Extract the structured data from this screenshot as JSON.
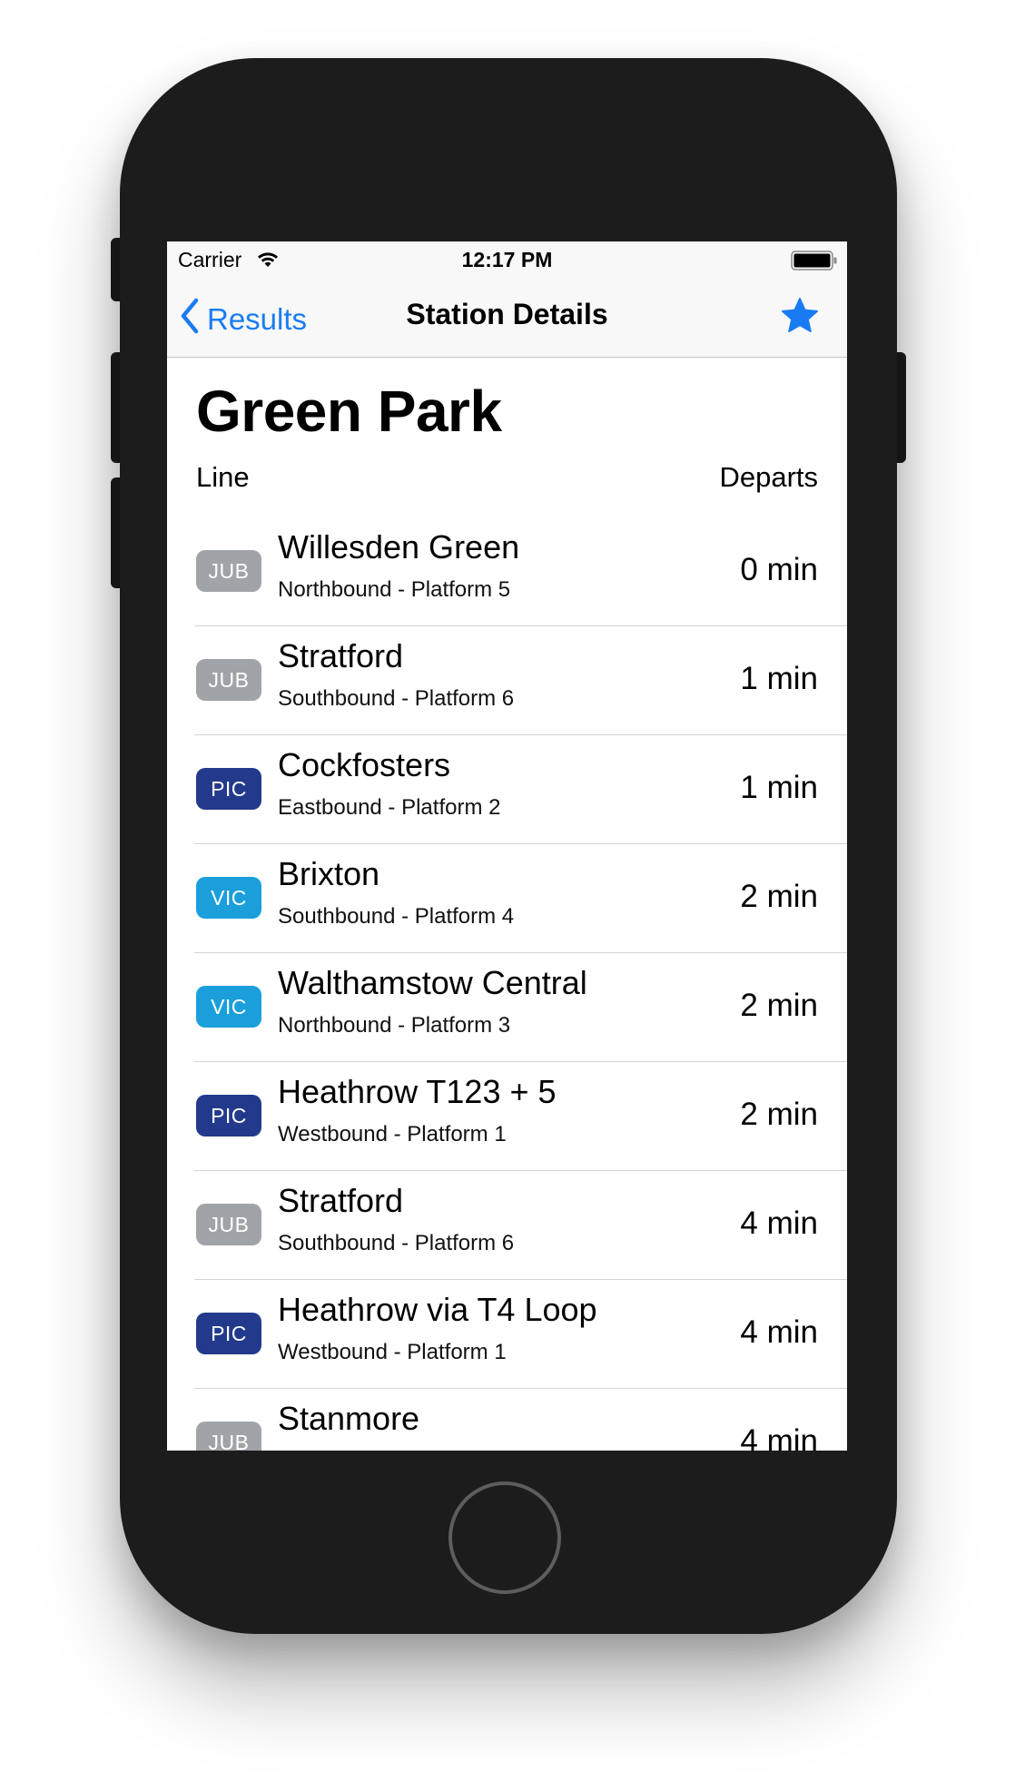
{
  "status_bar": {
    "carrier": "Carrier",
    "time": "12:17 PM"
  },
  "nav": {
    "back_label": "Results",
    "title": "Station Details",
    "favorite_icon": "star-icon"
  },
  "station": {
    "name": "Green Park",
    "col_line": "Line",
    "col_departs": "Departs"
  },
  "colors": {
    "accent": "#1a7cf2",
    "JUB": "#a0a3a7",
    "PIC": "#233a8c",
    "VIC": "#1a9fdb"
  },
  "departures": [
    {
      "line": "JUB",
      "destination": "Willesden Green",
      "platform": "Northbound - Platform 5",
      "departs": "0 min"
    },
    {
      "line": "JUB",
      "destination": "Stratford",
      "platform": "Southbound - Platform 6",
      "departs": "1 min"
    },
    {
      "line": "PIC",
      "destination": "Cockfosters",
      "platform": "Eastbound - Platform 2",
      "departs": "1 min"
    },
    {
      "line": "VIC",
      "destination": "Brixton",
      "platform": "Southbound - Platform 4",
      "departs": "2 min"
    },
    {
      "line": "VIC",
      "destination": "Walthamstow Central",
      "platform": "Northbound - Platform 3",
      "departs": "2 min"
    },
    {
      "line": "PIC",
      "destination": "Heathrow T123 + 5",
      "platform": "Westbound - Platform 1",
      "departs": "2 min"
    },
    {
      "line": "JUB",
      "destination": "Stratford",
      "platform": "Southbound - Platform 6",
      "departs": "4 min"
    },
    {
      "line": "PIC",
      "destination": "Heathrow via T4 Loop",
      "platform": "Westbound - Platform 1",
      "departs": "4 min"
    },
    {
      "line": "JUB",
      "destination": "Stanmore",
      "platform": "",
      "departs": "4 min"
    }
  ]
}
